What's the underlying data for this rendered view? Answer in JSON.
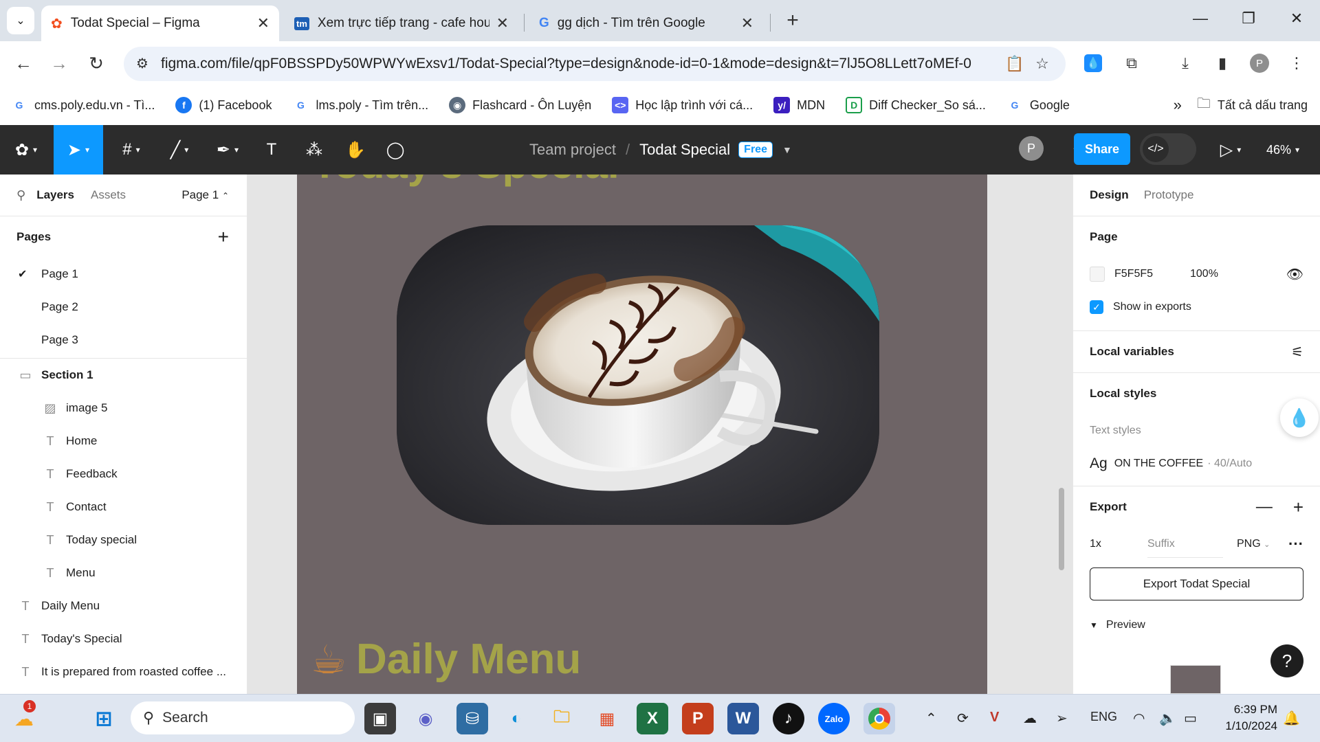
{
  "browser": {
    "tabs": [
      {
        "title": "Todat Special – Figma",
        "active": true
      },
      {
        "title": "Xem trực tiếp trang - cafe house",
        "active": false
      },
      {
        "title": "gg dịch - Tìm trên Google",
        "active": false
      }
    ],
    "url": "figma.com/file/qpF0BSSPDy50WPWYwExsv1/Todat-Special?type=design&node-id=0-1&mode=design&t=7lJ5O8LLett7oMEf-0",
    "bookmarks": [
      {
        "label": "cms.poly.edu.vn - Tì...",
        "icon": "google-icon",
        "color": "#4285f4"
      },
      {
        "label": "(1) Facebook",
        "icon": "facebook-icon",
        "color": "#1877f2"
      },
      {
        "label": "lms.poly - Tìm trên...",
        "icon": "google-icon",
        "color": "#4285f4"
      },
      {
        "label": "Flashcard - Ôn Luyện",
        "icon": "owl-icon",
        "color": "#5b6b7d"
      },
      {
        "label": "Học lập trình với cá...",
        "icon": "code-icon",
        "color": "#5865f2"
      },
      {
        "label": "MDN",
        "icon": "mdn-icon",
        "color": "#3b1fbf"
      },
      {
        "label": "Diff Checker_So sá...",
        "icon": "diffchecker-icon",
        "color": "#1a9e4a"
      },
      {
        "label": "Google",
        "icon": "google-icon",
        "color": "#4285f4"
      }
    ],
    "all_bookmarks": "Tất cả dấu trang"
  },
  "figma": {
    "team": "Team project",
    "file": "Todat Special",
    "plan_badge": "Free",
    "avatar_letter": "P",
    "share_label": "Share",
    "zoom": "46%",
    "left_panel": {
      "tab_layers": "Layers",
      "tab_assets": "Assets",
      "current_page": "Page 1",
      "pages_heading": "Pages",
      "pages": [
        "Page 1",
        "Page 2",
        "Page 3"
      ],
      "layers": [
        {
          "name": "Section 1",
          "type": "section",
          "indent": 0
        },
        {
          "name": "image 5",
          "type": "image",
          "indent": 1
        },
        {
          "name": "Home",
          "type": "text",
          "indent": 1
        },
        {
          "name": "Feedback",
          "type": "text",
          "indent": 1
        },
        {
          "name": "Contact",
          "type": "text",
          "indent": 1
        },
        {
          "name": "Today special",
          "type": "text",
          "indent": 1
        },
        {
          "name": "Menu",
          "type": "text",
          "indent": 1
        },
        {
          "name": "Daily Menu",
          "type": "text",
          "indent": 0
        },
        {
          "name": "Today's Special",
          "type": "text",
          "indent": 0
        },
        {
          "name": "It is prepared from roasted coffee ...",
          "type": "text",
          "indent": 0
        }
      ]
    },
    "canvas": {
      "top_heading_cut": "Today's Special",
      "daily_menu": "Daily Menu",
      "frame_color": "#6e6466",
      "accent_text": "#a4a349"
    },
    "right_panel": {
      "tab_design": "Design",
      "tab_prototype": "Prototype",
      "page_heading": "Page",
      "page_color": "F5F5F5",
      "page_opacity": "100%",
      "show_in_exports": "Show in exports",
      "local_variables": "Local variables",
      "local_styles": "Local styles",
      "text_styles": "Text styles",
      "style_sample": "Ag",
      "style_name": "ON THE COFFEE",
      "style_meta": "· 40/Auto",
      "export_heading": "Export",
      "export_scale": "1x",
      "export_suffix_placeholder": "Suffix",
      "export_format": "PNG",
      "export_button": "Export Todat Special",
      "preview_label": "Preview"
    }
  },
  "taskbar": {
    "search_placeholder": "Search",
    "notification_count": "1",
    "language": "ENG",
    "time": "6:39 PM",
    "date": "1/10/2024"
  }
}
